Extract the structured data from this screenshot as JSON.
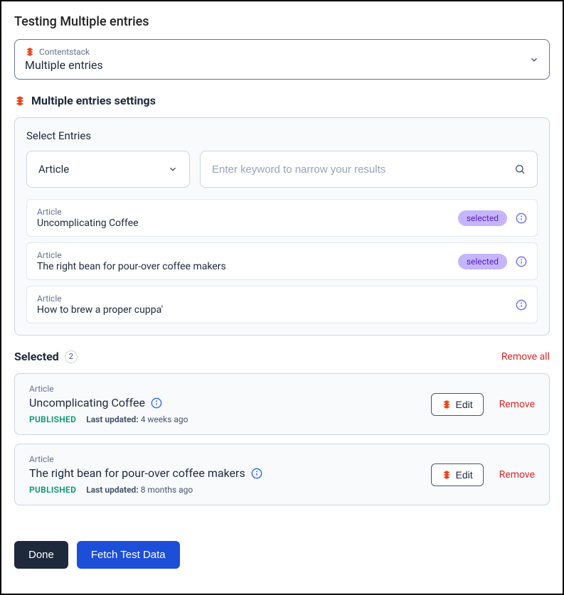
{
  "page_title": "Testing Multiple entries",
  "source": {
    "label": "Contentstack",
    "value": "Multiple entries"
  },
  "settings_title": "Multiple entries settings",
  "select_entries": {
    "label": "Select Entries",
    "type_dropdown": "Article",
    "search_placeholder": "Enter keyword to narrow your results"
  },
  "entries": [
    {
      "type": "Article",
      "title": "Uncomplicating Coffee",
      "selected": true
    },
    {
      "type": "Article",
      "title": "The right bean for pour-over coffee makers",
      "selected": true
    },
    {
      "type": "Article",
      "title": "How to brew a proper cuppa'",
      "selected": false
    }
  ],
  "selected_pill_label": "selected",
  "selected_section": {
    "title": "Selected",
    "count": "2",
    "remove_all": "Remove all"
  },
  "selected_items": [
    {
      "type": "Article",
      "title": "Uncomplicating Coffee",
      "status": "PUBLISHED",
      "last_updated_label": "Last updated:",
      "last_updated_value": "4 weeks ago"
    },
    {
      "type": "Article",
      "title": "The right bean for pour-over coffee makers",
      "status": "PUBLISHED",
      "last_updated_label": "Last updated:",
      "last_updated_value": "8 months ago"
    }
  ],
  "buttons": {
    "edit": "Edit",
    "remove": "Remove",
    "done": "Done",
    "fetch": "Fetch Test Data"
  }
}
